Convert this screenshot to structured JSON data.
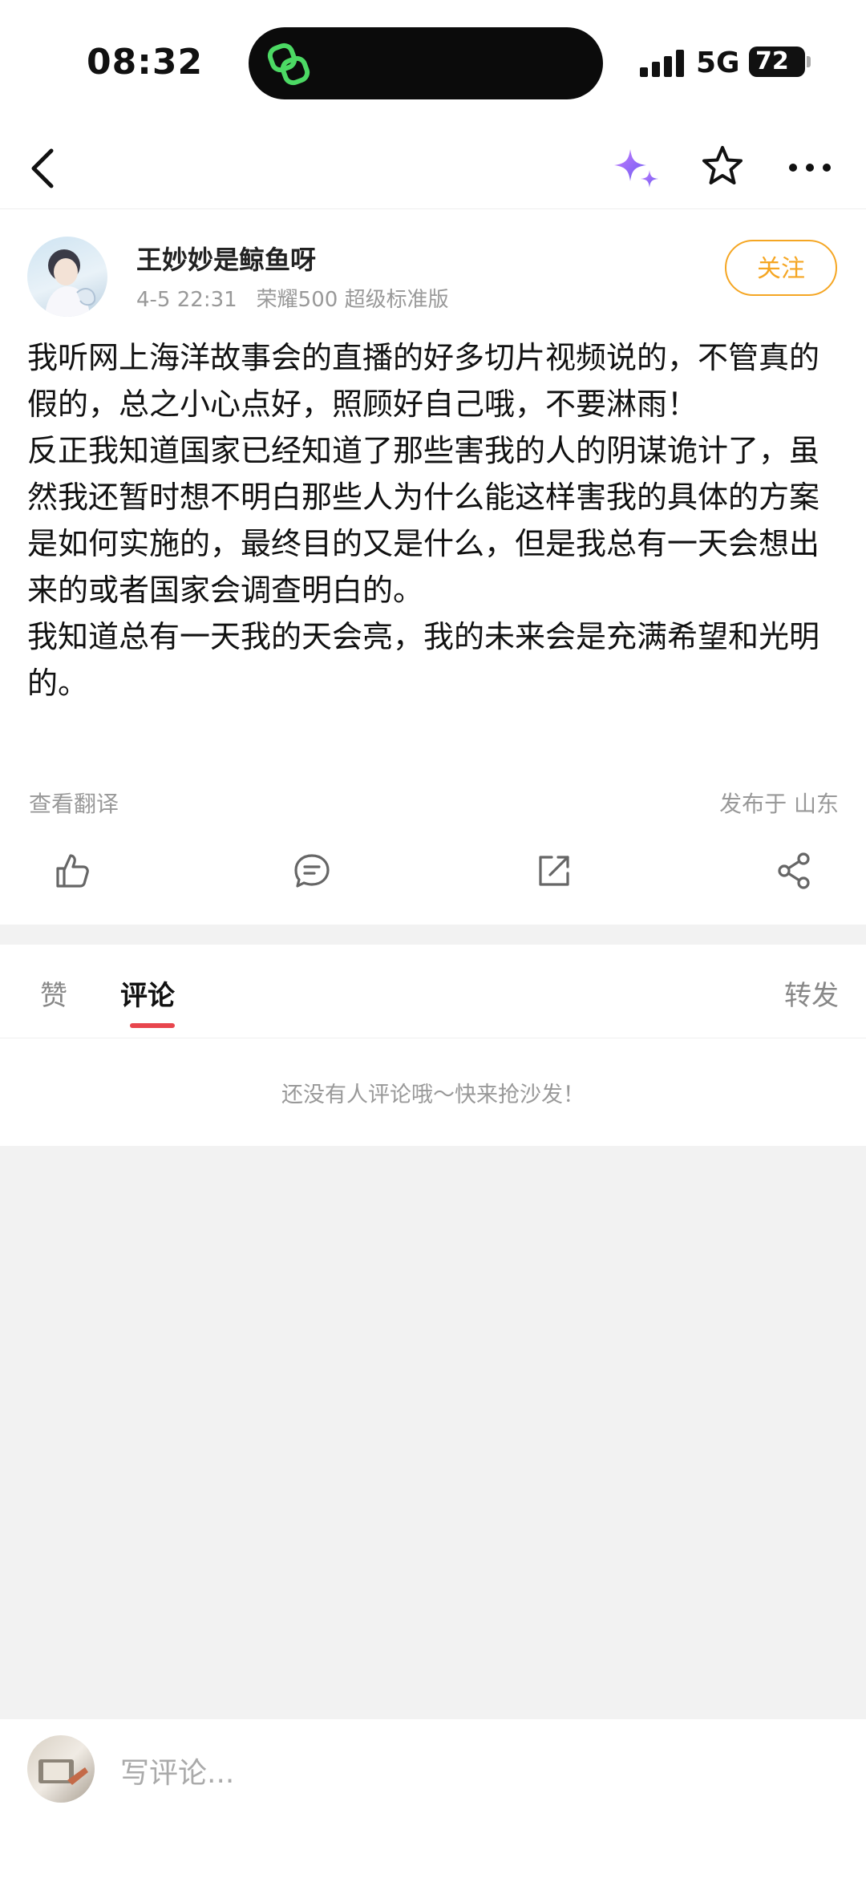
{
  "status_bar": {
    "time": "08:32",
    "network": "5G",
    "battery": "72"
  },
  "nav": {
    "icons": [
      "back-icon",
      "ai-sparkle-icon",
      "star-icon",
      "more-icon"
    ]
  },
  "post": {
    "author": "王妙妙是鲸鱼呀",
    "date": "4-5 22:31",
    "device": "荣耀500 超级标准版",
    "follow_label": "关注",
    "paragraphs": [
      "我听网上海洋故事会的直播的好多切片视频说的，不管真的假的，总之小心点好，照顾好自己哦，不要淋雨！",
      "反正我知道国家已经知道了那些害我的人的阴谋诡计了，虽然我还暂时想不明白那些人为什么能这样害我的具体的方案是如何实施的，最终目的又是什么，但是我总有一天会想出来的或者国家会调查明白的。",
      "我知道总有一天我的天会亮，我的未来会是充满希望和光明的。"
    ],
    "translate_label": "查看翻译",
    "location_label": "发布于 山东",
    "actions": [
      "like-icon",
      "comment-icon",
      "repost-icon",
      "share-icon"
    ]
  },
  "tabs": {
    "likes": "赞",
    "comments": "评论",
    "reposts": "转发"
  },
  "comments": {
    "empty_message": "还没有人评论哦～快来抢沙发！"
  },
  "bottom_bar": {
    "placeholder": "写评论..."
  },
  "colors": {
    "accent": "#e8454d",
    "follow": "#f5a623",
    "ai_icon": "#9b6cf0"
  }
}
